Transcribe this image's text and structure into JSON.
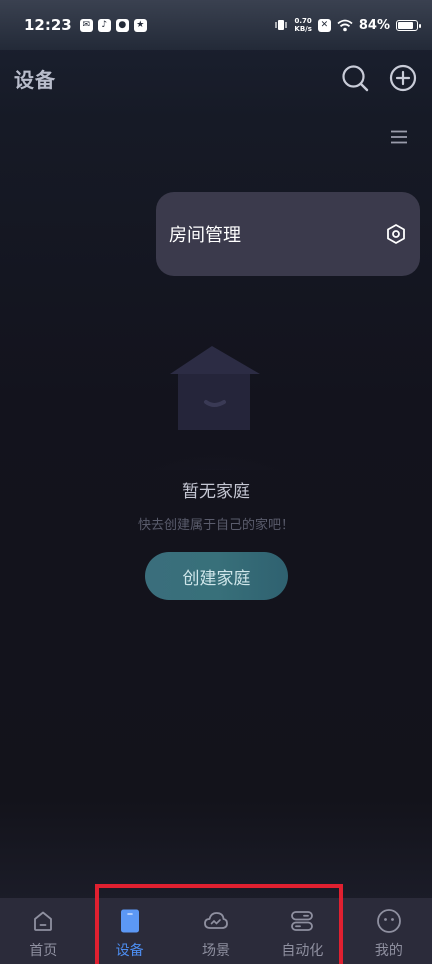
{
  "status_bar": {
    "time": "12:23",
    "net_speed_value": "0.70",
    "net_speed_unit": "KB/s",
    "battery": "84%",
    "battery_level": 0.84
  },
  "header": {
    "title": "设备"
  },
  "room_popup": {
    "label": "房间管理"
  },
  "empty_state": {
    "title": "暂无家庭",
    "subtitle": "快去创建属于自己的家吧！",
    "button_label": "创建家庭"
  },
  "tabs": [
    {
      "label": "首页",
      "icon": "home-icon",
      "active": false
    },
    {
      "label": "设备",
      "icon": "device-icon",
      "active": true
    },
    {
      "label": "场景",
      "icon": "scene-icon",
      "active": false
    },
    {
      "label": "自动化",
      "icon": "automation-icon",
      "active": false
    },
    {
      "label": "我的",
      "icon": "profile-icon",
      "active": false
    }
  ],
  "colors": {
    "accent": "#4d8df0",
    "button": "#38707a",
    "highlight": "#e02030"
  }
}
